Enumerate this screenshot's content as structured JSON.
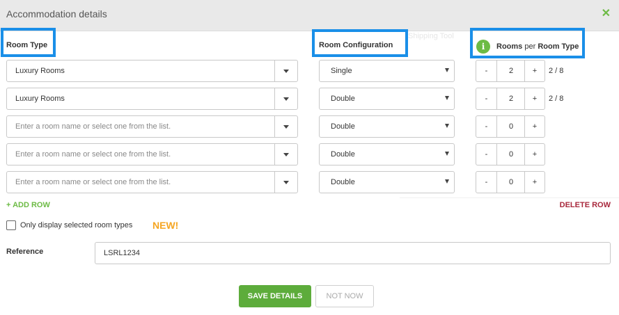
{
  "modal": {
    "title": "Accommodation details",
    "close_icon": "close-icon",
    "accent_color": "#6dbb45"
  },
  "background_hint": "Shipping Tool",
  "columns": {
    "room_type": "Room Type",
    "room_configuration": "Room Configuration",
    "rooms_word": "Rooms",
    "per_word": "per",
    "room_type_word": "Room Type",
    "info_icon": "i"
  },
  "rows": [
    {
      "room_type": "Luxury Rooms",
      "configuration": "Single",
      "quantity": "2",
      "ratio": "2 / 8"
    },
    {
      "room_type": "Luxury Rooms",
      "configuration": "Double",
      "quantity": "2",
      "ratio": "2 / 8"
    },
    {
      "room_type": "Enter a room name or select one from the list.",
      "configuration": "Double",
      "quantity": "0",
      "ratio": ""
    },
    {
      "room_type": "Enter a room name or select one from the list.",
      "configuration": "Double",
      "quantity": "0",
      "ratio": ""
    },
    {
      "room_type": "Enter a room name or select one from the list.",
      "configuration": "Double",
      "quantity": "0",
      "ratio": ""
    }
  ],
  "stepper": {
    "minus": "-",
    "plus": "+"
  },
  "actions": {
    "add_row": "+ ADD ROW",
    "delete_row": "DELETE ROW"
  },
  "filter": {
    "label": "Only display selected room types",
    "badge": "NEW!"
  },
  "reference": {
    "label": "Reference",
    "value": "LSRL1234"
  },
  "buttons": {
    "save": "SAVE DETAILS",
    "not_now": "NOT NOW"
  },
  "colors": {
    "green": "#5dac3b",
    "highlight": "#1a8fe8",
    "delete": "#a8283c",
    "new": "#f5a623"
  }
}
